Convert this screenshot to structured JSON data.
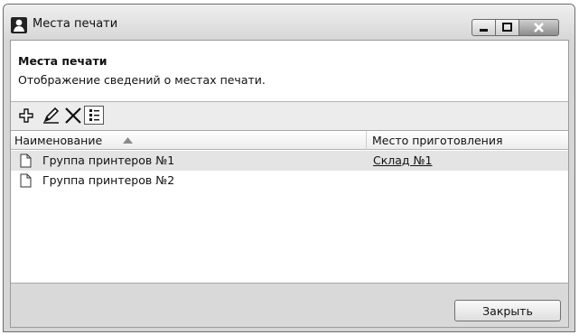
{
  "window": {
    "title": "Места печати",
    "controls": {
      "minimize_icon": "minimize-icon",
      "maximize_icon": "maximize-icon",
      "close_icon": "close-icon"
    }
  },
  "header": {
    "title": "Места печати",
    "description": "Отображение сведений о местах печати."
  },
  "toolbar": {
    "icons": [
      "add-icon",
      "edit-icon",
      "delete-icon",
      "view-mode-icon"
    ]
  },
  "grid": {
    "columns": [
      {
        "label": "Наименование",
        "sort": "ascending"
      },
      {
        "label": "Место приготовления"
      }
    ],
    "rows": [
      {
        "name": "Группа принтеров №1",
        "place": "Склад №1",
        "selected": true
      },
      {
        "name": "Группа принтеров №2",
        "place": "",
        "selected": false
      }
    ]
  },
  "footer": {
    "close_label": "Закрыть"
  },
  "colors": {
    "window_bg": "#d6d6d6",
    "selected_row": "#e4e4e4"
  }
}
